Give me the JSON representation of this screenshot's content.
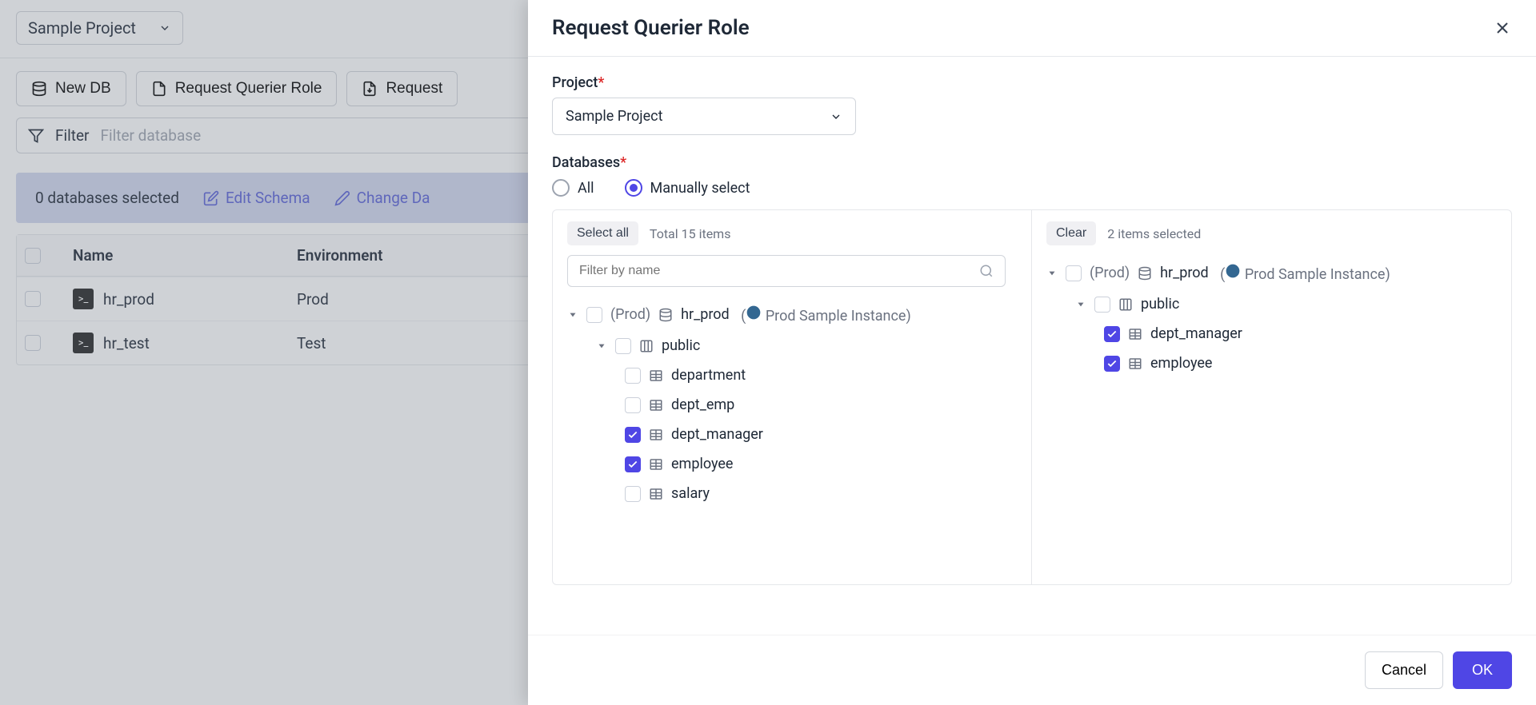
{
  "project_selector": {
    "value": "Sample Project"
  },
  "toolbar": {
    "new_db": "New DB",
    "request_querier": "Request Querier Role",
    "request_more": "Request"
  },
  "filter": {
    "label": "Filter",
    "placeholder": "Filter database"
  },
  "selection_bar": {
    "status": "0 databases selected",
    "edit_schema": "Edit Schema",
    "change_data": "Change Da"
  },
  "table": {
    "col_name": "Name",
    "col_env": "Environment",
    "rows": [
      {
        "name": "hr_prod",
        "env": "Prod"
      },
      {
        "name": "hr_test",
        "env": "Test"
      }
    ]
  },
  "modal": {
    "title": "Request Querier Role",
    "project_label": "Project",
    "project_value": "Sample Project",
    "db_label": "Databases",
    "radio_all": "All",
    "radio_manual": "Manually select",
    "left": {
      "select_all": "Select all",
      "total_items": "Total 15 items",
      "filter_placeholder": "Filter by name",
      "env": "(Prod)",
      "db": "hr_prod",
      "instance": "Prod Sample Instance",
      "schema": "public",
      "tables": [
        "department",
        "dept_emp",
        "dept_manager",
        "employee",
        "salary"
      ],
      "checked": [
        "dept_manager",
        "employee"
      ]
    },
    "right": {
      "clear": "Clear",
      "selected_count": "2 items selected",
      "env": "(Prod)",
      "db": "hr_prod",
      "instance": "Prod Sample Instance",
      "schema": "public",
      "tables": [
        "dept_manager",
        "employee"
      ]
    },
    "cancel": "Cancel",
    "ok": "OK"
  }
}
